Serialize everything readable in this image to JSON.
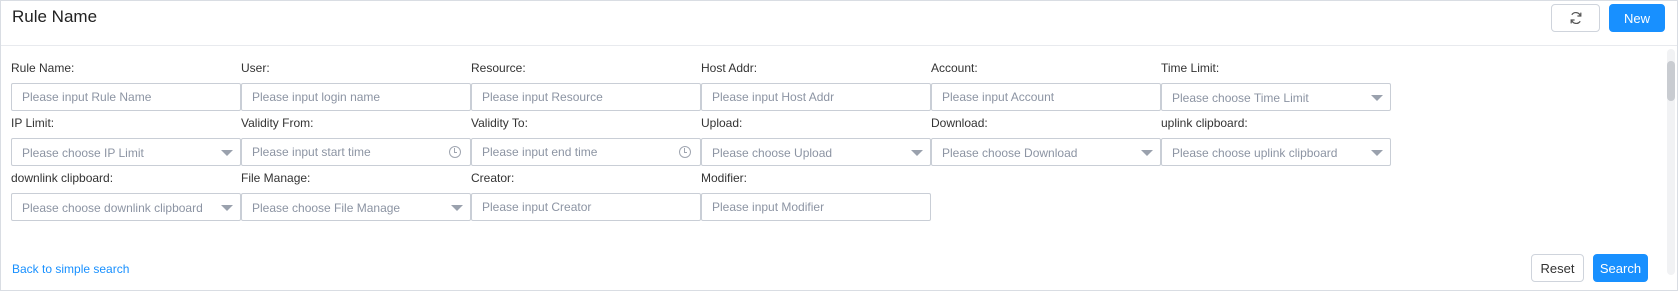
{
  "header": {
    "title": "Rule Name",
    "refresh_icon": "refresh-icon",
    "new_label": "New"
  },
  "fields": {
    "rule_name": {
      "label": "Rule Name:",
      "placeholder": "Please input Rule Name"
    },
    "user": {
      "label": "User:",
      "placeholder": "Please input login name"
    },
    "resource": {
      "label": "Resource:",
      "placeholder": "Please input Resource"
    },
    "host_addr": {
      "label": "Host Addr:",
      "placeholder": "Please input Host Addr"
    },
    "account": {
      "label": "Account:",
      "placeholder": "Please input Account"
    },
    "time_limit": {
      "label": "Time Limit:",
      "placeholder": "Please choose Time Limit"
    },
    "ip_limit": {
      "label": "IP Limit:",
      "placeholder": "Please choose IP Limit"
    },
    "validity_from": {
      "label": "Validity From:",
      "placeholder": "Please input start time"
    },
    "validity_to": {
      "label": "Validity To:",
      "placeholder": "Please input end time"
    },
    "upload": {
      "label": "Upload:",
      "placeholder": "Please choose Upload"
    },
    "download": {
      "label": "Download:",
      "placeholder": "Please choose Download"
    },
    "uplink_clipboard": {
      "label": "uplink clipboard:",
      "placeholder": "Please choose uplink clipboard"
    },
    "downlink_clipboard": {
      "label": "downlink clipboard:",
      "placeholder": "Please choose downlink clipboard"
    },
    "file_manage": {
      "label": "File Manage:",
      "placeholder": "Please choose File Manage"
    },
    "creator": {
      "label": "Creator:",
      "placeholder": "Please input Creator"
    },
    "modifier": {
      "label": "Modifier:",
      "placeholder": "Please input Modifier"
    }
  },
  "footer": {
    "back_link": "Back to simple search",
    "reset_label": "Reset",
    "search_label": "Search"
  },
  "colors": {
    "primary": "#1890ff",
    "border": "#c9ced6",
    "placeholder": "#8c94a3"
  },
  "icons": {
    "select_caret": "chevron-down-icon",
    "time_picker": "clock-icon"
  }
}
